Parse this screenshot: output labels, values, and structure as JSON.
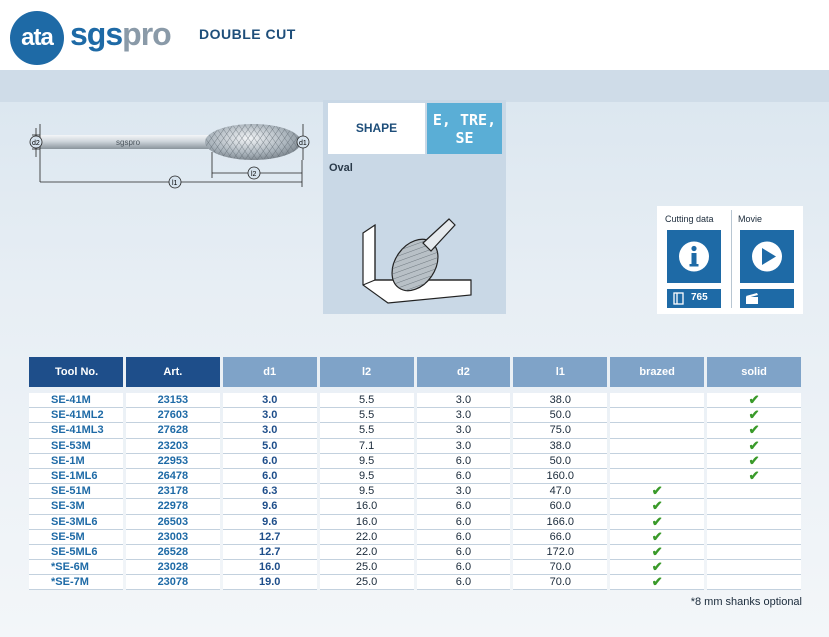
{
  "brand": {
    "ata": "ata",
    "sgs": "sgs",
    "pro": "pro"
  },
  "document": {
    "title": "DOUBLE CUT"
  },
  "drawing": {
    "brand_mark": "sgspro",
    "dim_d2": "d2",
    "dim_d1": "d1",
    "dim_l1": "l1",
    "dim_l2": "l2"
  },
  "shape": {
    "label": "SHAPE",
    "code_line1": "E, TRE,",
    "code_line2": "SE",
    "name": "Oval"
  },
  "media": {
    "cutting_data_title": "Cutting data",
    "cutting_data_count": "765",
    "movie_title": "Movie"
  },
  "table": {
    "headers": [
      "Tool No.",
      "Art.",
      "d1",
      "l2",
      "d2",
      "l1",
      "brazed",
      "solid"
    ],
    "rows": [
      {
        "tool": "SE-41M",
        "art": "23153",
        "d1": "3.0",
        "l2": "5.5",
        "d2": "3.0",
        "l1": "38.0",
        "brazed": "",
        "solid": "✔"
      },
      {
        "tool": "SE-41ML2",
        "art": "27603",
        "d1": "3.0",
        "l2": "5.5",
        "d2": "3.0",
        "l1": "50.0",
        "brazed": "",
        "solid": "✔"
      },
      {
        "tool": "SE-41ML3",
        "art": "27628",
        "d1": "3.0",
        "l2": "5.5",
        "d2": "3.0",
        "l1": "75.0",
        "brazed": "",
        "solid": "✔"
      },
      {
        "tool": "SE-53M",
        "art": "23203",
        "d1": "5.0",
        "l2": "7.1",
        "d2": "3.0",
        "l1": "38.0",
        "brazed": "",
        "solid": "✔"
      },
      {
        "tool": "SE-1M",
        "art": "22953",
        "d1": "6.0",
        "l2": "9.5",
        "d2": "6.0",
        "l1": "50.0",
        "brazed": "",
        "solid": "✔"
      },
      {
        "tool": "SE-1ML6",
        "art": "26478",
        "d1": "6.0",
        "l2": "9.5",
        "d2": "6.0",
        "l1": "160.0",
        "brazed": "",
        "solid": "✔"
      },
      {
        "tool": "SE-51M",
        "art": "23178",
        "d1": "6.3",
        "l2": "9.5",
        "d2": "3.0",
        "l1": "47.0",
        "brazed": "✔",
        "solid": ""
      },
      {
        "tool": "SE-3M",
        "art": "22978",
        "d1": "9.6",
        "l2": "16.0",
        "d2": "6.0",
        "l1": "60.0",
        "brazed": "✔",
        "solid": ""
      },
      {
        "tool": "SE-3ML6",
        "art": "26503",
        "d1": "9.6",
        "l2": "16.0",
        "d2": "6.0",
        "l1": "166.0",
        "brazed": "✔",
        "solid": ""
      },
      {
        "tool": "SE-5M",
        "art": "23003",
        "d1": "12.7",
        "l2": "22.0",
        "d2": "6.0",
        "l1": "66.0",
        "brazed": "✔",
        "solid": ""
      },
      {
        "tool": "SE-5ML6",
        "art": "26528",
        "d1": "12.7",
        "l2": "22.0",
        "d2": "6.0",
        "l1": "172.0",
        "brazed": "✔",
        "solid": ""
      },
      {
        "tool": "*SE-6M",
        "art": "23028",
        "d1": "16.0",
        "l2": "25.0",
        "d2": "6.0",
        "l1": "70.0",
        "brazed": "✔",
        "solid": ""
      },
      {
        "tool": "*SE-7M",
        "art": "23078",
        "d1": "19.0",
        "l2": "25.0",
        "d2": "6.0",
        "l1": "70.0",
        "brazed": "✔",
        "solid": ""
      }
    ]
  },
  "footnote": "*8 mm shanks optional",
  "colors": {
    "brand_blue": "#1e6aa6",
    "header_dark": "#1e4e8a",
    "header_light": "#7fa3c8",
    "shape_code": "#5aaed6",
    "check_green": "#3a9a2a"
  },
  "icons": [
    "info-icon",
    "play-icon",
    "book-icon",
    "clapper-icon",
    "checkmark-icon"
  ]
}
